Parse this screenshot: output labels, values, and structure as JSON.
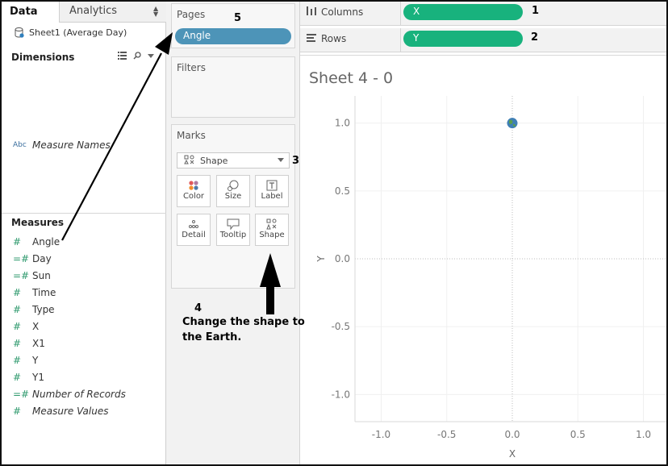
{
  "data_pane": {
    "tab_data": "Data",
    "tab_analytics": "Analytics",
    "datasource": "Sheet1 (Average Day)",
    "dimensions_title": "Dimensions",
    "dimensions": [
      {
        "label": "Measure Names",
        "type_icon": "Abc",
        "italic": true
      }
    ],
    "measures_title": "Measures",
    "measures": [
      {
        "label": "Angle",
        "type_icon": "#",
        "italic": false
      },
      {
        "label": "Day",
        "type_icon": "=#",
        "italic": false
      },
      {
        "label": "Sun",
        "type_icon": "=#",
        "italic": false
      },
      {
        "label": "Time",
        "type_icon": "#",
        "italic": false
      },
      {
        "label": "Type",
        "type_icon": "#",
        "italic": false
      },
      {
        "label": "X",
        "type_icon": "#",
        "italic": false
      },
      {
        "label": "X1",
        "type_icon": "#",
        "italic": false
      },
      {
        "label": "Y",
        "type_icon": "#",
        "italic": false
      },
      {
        "label": "Y1",
        "type_icon": "#",
        "italic": false
      },
      {
        "label": "Number of Records",
        "type_icon": "=#",
        "italic": true
      },
      {
        "label": "Measure Values",
        "type_icon": "#",
        "italic": true
      }
    ]
  },
  "cards": {
    "pages_title": "Pages",
    "pages_pill": "Angle",
    "filters_title": "Filters",
    "marks_title": "Marks",
    "mark_type": "Shape",
    "mark_buttons": [
      {
        "label": "Color",
        "icon": "color-dots-icon"
      },
      {
        "label": "Size",
        "icon": "size-icon"
      },
      {
        "label": "Label",
        "icon": "label-icon"
      },
      {
        "label": "Detail",
        "icon": "detail-icon"
      },
      {
        "label": "Tooltip",
        "icon": "tooltip-icon"
      },
      {
        "label": "Shape",
        "icon": "shape-icon"
      }
    ]
  },
  "shelves": {
    "columns_label": "Columns",
    "columns_pill": "X",
    "rows_label": "Rows",
    "rows_pill": "Y"
  },
  "sheet_title": "Sheet 4 - 0",
  "chart_data": {
    "type": "scatter",
    "xlabel": "X",
    "ylabel": "Y",
    "xlim": [
      -1.2,
      1.2
    ],
    "ylim": [
      -1.2,
      1.2
    ],
    "xticks": [
      "-1.0",
      "-0.5",
      "0.0",
      "0.5",
      "1.0"
    ],
    "yticks": [
      "1.0",
      "0.5",
      "0.0",
      "-0.5",
      "-1.0"
    ],
    "grid": true,
    "points": [
      {
        "x": 0.0,
        "y": 1.0,
        "shape": "earth-icon"
      }
    ]
  },
  "annotations": {
    "n1": "1",
    "n2": "2",
    "n3": "3",
    "n4": "4",
    "n5": "5",
    "instruction_line1": "Change the shape to",
    "instruction_line2": "the Earth."
  },
  "colors": {
    "green_pill": "#18b27d",
    "blue_pill": "#4d94b8",
    "earth": "#3f7fb5"
  }
}
